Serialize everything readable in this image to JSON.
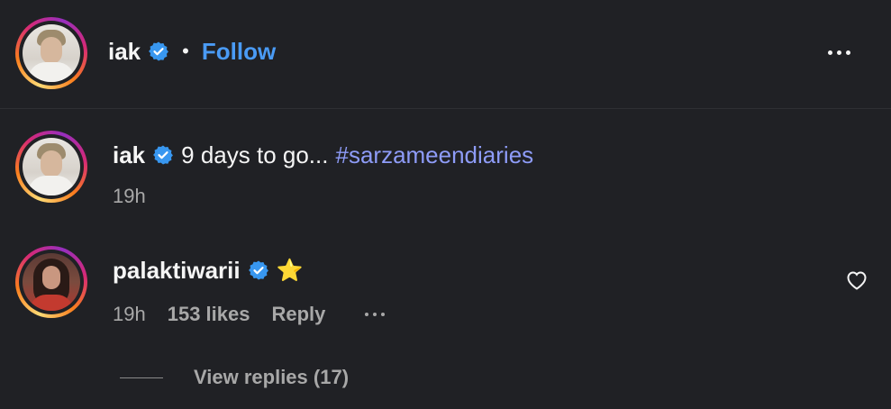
{
  "post_header": {
    "username": "iak",
    "separator": "•",
    "follow_label": "Follow"
  },
  "caption": {
    "username": "iak",
    "text": "9 days to go...",
    "hashtag": "#sarzameendiaries",
    "time": "19h"
  },
  "comment": {
    "username": "palaktiwarii",
    "text": "⭐",
    "time": "19h",
    "likes": "153 likes",
    "reply_label": "Reply",
    "view_replies": "View replies (17)"
  },
  "icons": {
    "verified": "verified-badge-icon",
    "more": "more-options-icon",
    "like": "heart-icon"
  },
  "colors": {
    "background": "#202125",
    "link": "#4a9bf5",
    "hashtag": "#8e9cf8",
    "verified": "#3897f0"
  }
}
